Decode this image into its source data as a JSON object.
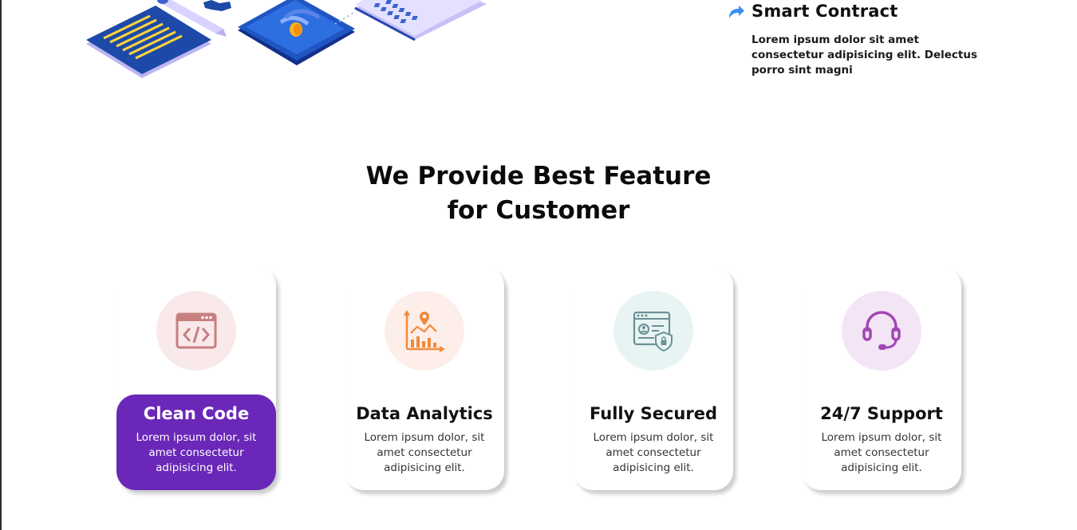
{
  "top": {
    "contract_title": "Smart Contract",
    "contract_text": "Lorem ipsum dolor sit amet consectetur adipisicing elit. Delectus porro sint magni"
  },
  "section": {
    "title_line1": "We Provide Best Feature",
    "title_line2": "for Customer"
  },
  "features": [
    {
      "title": "Clean Code",
      "text": "Lorem ipsum dolor, sit amet consectetur adipisicing elit.",
      "icon": "code-window-icon",
      "icon_bg": "#f9e9ea",
      "icon_color": "#c87f80",
      "active": true
    },
    {
      "title": "Data Analytics",
      "text": "Lorem ipsum dolor, sit amet consectetur adipisicing elit.",
      "icon": "analytics-chart-icon",
      "icon_bg": "#fdeee9",
      "icon_color": "#f08a3c",
      "active": false
    },
    {
      "title": "Fully Secured",
      "text": "Lorem ipsum dolor, sit amet consectetur adipisicing elit.",
      "icon": "secure-profile-icon",
      "icon_bg": "#e8f4f4",
      "icon_color": "#6a9092",
      "active": false
    },
    {
      "title": "24/7 Support",
      "text": "Lorem ipsum dolor, sit amet consectetur adipisicing elit.",
      "icon": "headset-icon",
      "icon_bg": "#f3e5f6",
      "icon_color": "#a247b4",
      "active": false
    }
  ],
  "colors": {
    "active_card": "#6a27b8",
    "arrow": "#3b8ff0"
  }
}
